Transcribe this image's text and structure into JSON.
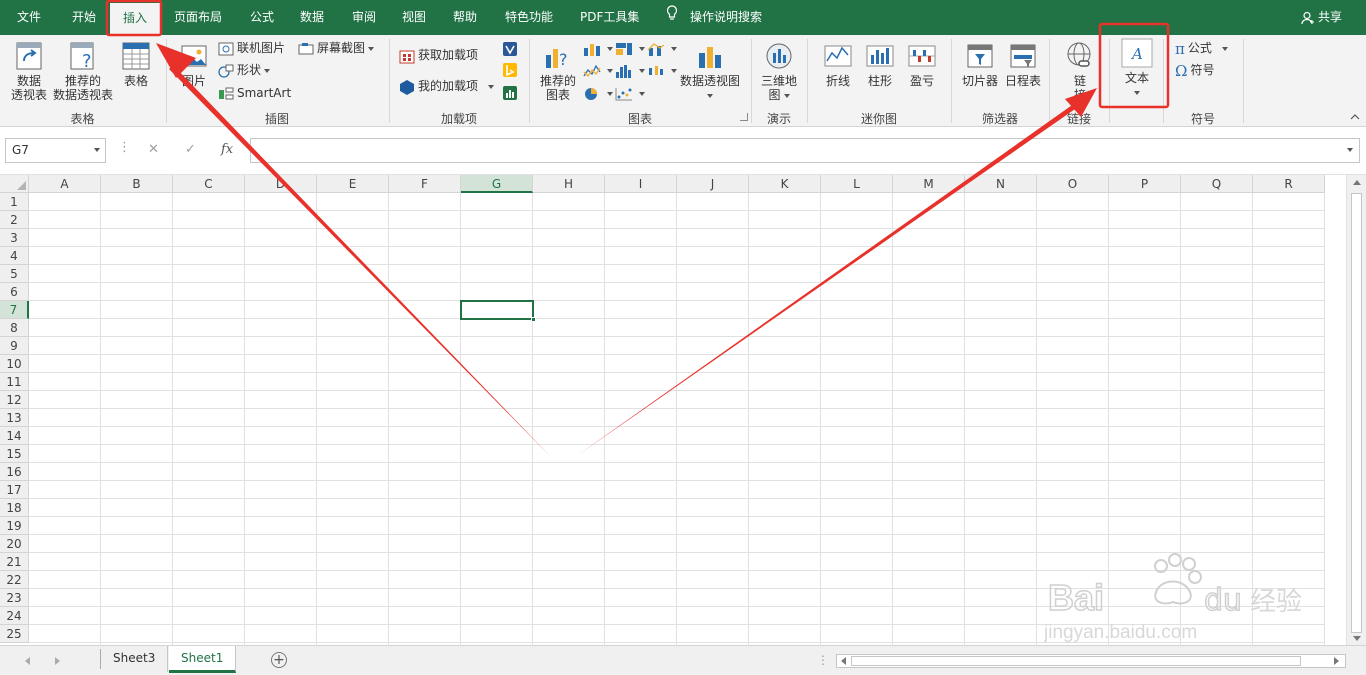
{
  "tabs": [
    {
      "label": "文件",
      "active": false
    },
    {
      "label": "开始",
      "active": false
    },
    {
      "label": "插入",
      "active": true
    },
    {
      "label": "页面布局",
      "active": false
    },
    {
      "label": "公式",
      "active": false
    },
    {
      "label": "数据",
      "active": false
    },
    {
      "label": "审阅",
      "active": false
    },
    {
      "label": "视图",
      "active": false
    },
    {
      "label": "帮助",
      "active": false
    },
    {
      "label": "特色功能",
      "active": false
    },
    {
      "label": "PDF工具集",
      "active": false
    }
  ],
  "tell_me": "操作说明搜索",
  "share": "共享",
  "ribbon": {
    "groups": {
      "tables": "表格",
      "illustrations": "插图",
      "addins": "加载项",
      "charts": "图表",
      "tours": "演示",
      "sparklines": "迷你图",
      "filters": "筛选器",
      "links": "链接",
      "symbols": "符号"
    },
    "buttons": {
      "pivot_table_l1": "数据",
      "pivot_table_l2": "透视表",
      "rec_pivot_l1": "推荐的",
      "rec_pivot_l2": "数据透视表",
      "table": "表格",
      "pictures": "图片",
      "online_pictures": "联机图片",
      "shapes": "形状",
      "smartart": "SmartArt",
      "screenshot": "屏幕截图",
      "get_addins": "获取加载项",
      "my_addins": "我的加载项",
      "rec_charts_l1": "推荐的",
      "rec_charts_l2": "图表",
      "pivot_chart": "数据透视图",
      "map3d_l1": "三维地",
      "map3d_l2": "图",
      "line": "折线",
      "column": "柱形",
      "winloss": "盈亏",
      "slicer": "切片器",
      "timeline": "日程表",
      "link_l1": "链",
      "link_l2": "接",
      "text": "文本",
      "equation": "公式",
      "symbol": "符号",
      "fx": "fx"
    }
  },
  "formula_bar": {
    "name_box": "G7",
    "formula": ""
  },
  "grid": {
    "columns": [
      "A",
      "B",
      "C",
      "D",
      "E",
      "F",
      "G",
      "H",
      "I",
      "J",
      "K",
      "L",
      "M",
      "N",
      "O",
      "P",
      "Q",
      "R"
    ],
    "rows": [
      "1",
      "2",
      "3",
      "4",
      "5",
      "6",
      "7",
      "8",
      "9",
      "10",
      "11",
      "12",
      "13",
      "14",
      "15",
      "16",
      "17",
      "18",
      "19",
      "20",
      "21",
      "22",
      "23",
      "24",
      "25"
    ],
    "active_cell": "G7"
  },
  "sheets": [
    {
      "name": "Sheet3",
      "active": false
    },
    {
      "name": "Sheet1",
      "active": true
    }
  ],
  "colors": {
    "excel_green": "#217346",
    "annotation_red": "#e8312a"
  },
  "watermark": {
    "brand": "Baidu经验",
    "url": "jingyan.baidu.com"
  }
}
